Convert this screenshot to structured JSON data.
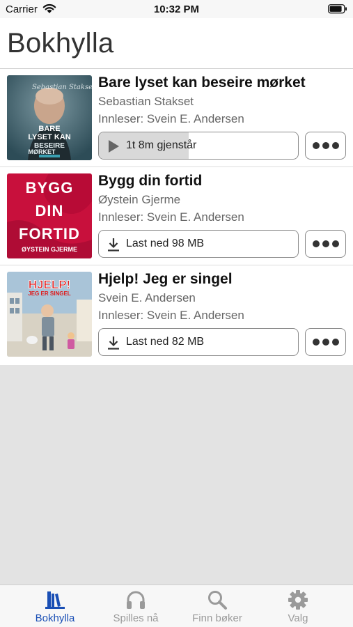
{
  "status_bar": {
    "carrier": "Carrier",
    "time": "10:32 PM"
  },
  "header": {
    "title": "Bokhylla"
  },
  "books": [
    {
      "title": "Bare lyset kan beseire mørket",
      "author": "Sebastian Stakset",
      "narrator": "Innleser: Svein E. Andersen",
      "action_label": "1t 8m gjenstår",
      "action_icon": "play-icon",
      "progress": 0.45,
      "cover": {
        "text_lines": [
          "BARE",
          "LYSET KAN",
          "BESEIRE",
          "MØRKET"
        ],
        "signature": "Sebastian Stakset",
        "colors": {
          "background": "#3f6470",
          "text": "#ffffff"
        }
      }
    },
    {
      "title": "Bygg din fortid",
      "author": "Øystein Gjerme",
      "narrator": "Innleser: Svein E. Andersen",
      "action_label": "Last ned 98 MB",
      "action_icon": "download-icon",
      "cover": {
        "text_lines": [
          "BYGG",
          "DIN",
          "FORTID"
        ],
        "author_line": "ØYSTEIN GJERME",
        "colors": {
          "background": "#c8103c",
          "text": "#ffffff"
        }
      }
    },
    {
      "title": "Hjelp! Jeg er singel",
      "author": "Svein E. Andersen",
      "narrator": "Innleser: Svein E. Andersen",
      "action_label": "Last ned 82 MB",
      "action_icon": "download-icon",
      "cover": {
        "text_lines": [
          "HJELP!",
          "JEG ER SINGEL"
        ],
        "colors": {
          "background": "#8fb3cf",
          "text": "#e01818"
        }
      }
    }
  ],
  "tab_bar": {
    "tabs": [
      {
        "label": "Bokhylla",
        "icon": "bookshelf-icon",
        "active": true
      },
      {
        "label": "Spilles nå",
        "icon": "headphones-icon",
        "active": false
      },
      {
        "label": "Finn bøker",
        "icon": "search-icon",
        "active": false
      },
      {
        "label": "Valg",
        "icon": "gear-icon",
        "active": false
      }
    ]
  },
  "colors": {
    "active_tab": "#1a4fb5",
    "inactive_tab": "#9a9a9a",
    "background": "#e3e3e3"
  }
}
